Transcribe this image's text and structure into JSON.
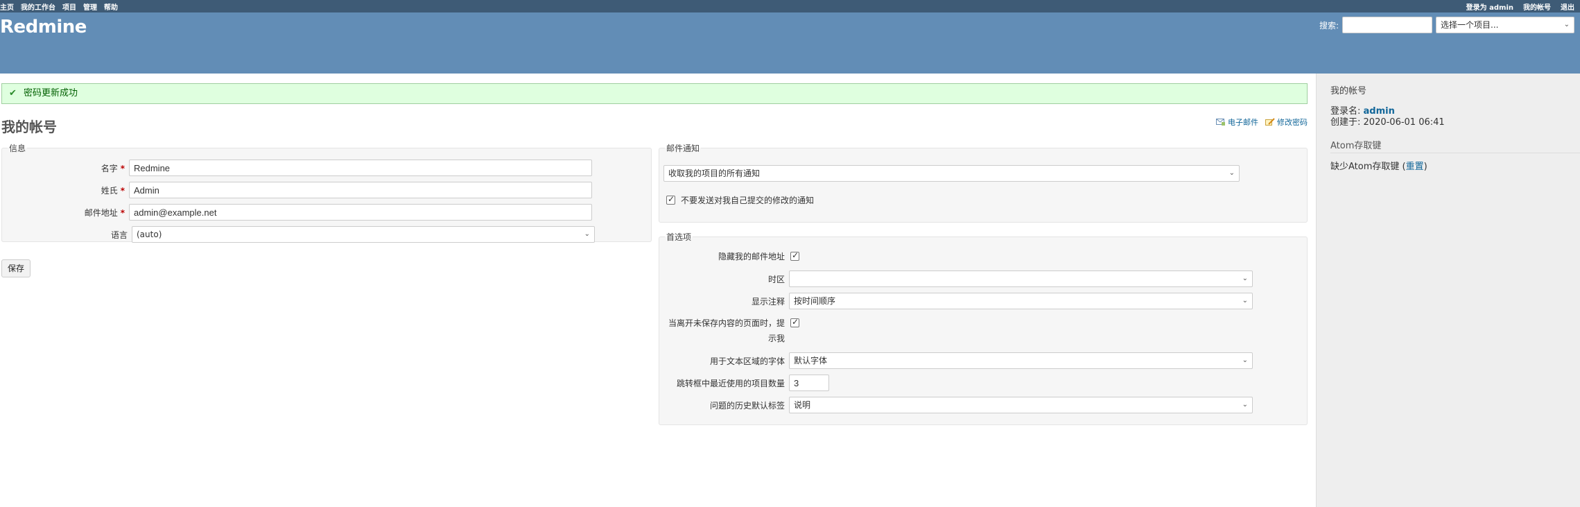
{
  "top_menu": {
    "left": [
      "主页",
      "我的工作台",
      "项目",
      "管理",
      "帮助"
    ],
    "logged_as_prefix": "登录为",
    "user": "admin",
    "my_account": "我的帐号",
    "logout": "退出"
  },
  "header": {
    "title": "Redmine",
    "search_label": "搜索:",
    "search_value": "",
    "project_jump": "选择一个项目..."
  },
  "flash": "密码更新成功",
  "page_title": "我的帐号",
  "contextual": {
    "email_link": "电子邮件",
    "password_link": "修改密码"
  },
  "info": {
    "legend": "信息",
    "fields": [
      {
        "label": "名字",
        "required": true,
        "value": "Redmine"
      },
      {
        "label": "姓氏",
        "required": true,
        "value": "Admin"
      },
      {
        "label": "邮件地址",
        "required": true,
        "value": "admin@example.net"
      }
    ],
    "language_label": "语言",
    "language_value": "(auto)"
  },
  "save_button": "保存",
  "mail": {
    "legend": "邮件通知",
    "select_value": "收取我的项目的所有通知",
    "no_self_notified_label": "不要发送对我自己提交的修改的通知",
    "no_self_notified_checked": true
  },
  "prefs": {
    "legend": "首选项",
    "hide_mail_label": "隐藏我的邮件地址",
    "hide_mail_checked": true,
    "timezone_label": "时区",
    "timezone_value": "",
    "comments_label": "显示注释",
    "comments_value": "按时间顺序",
    "warn_label_1": "当离开未保存内容的页面时，提",
    "warn_label_2": "示我",
    "warn_checked": true,
    "font_label": "用于文本区域的字体",
    "font_value": "默认字体",
    "recent_label": "跳转框中最近使用的项目数量",
    "recent_value": "3",
    "history_label": "问题的历史默认标签",
    "history_value": "说明"
  },
  "sidebar": {
    "title": "我的帐号",
    "login_label": "登录名:",
    "login_value": "admin",
    "created_label": "创建于:",
    "created_value": "2020-06-01 06:41",
    "atom_title": "Atom存取键",
    "atom_missing": "缺少Atom存取键",
    "reset_link": "重置"
  }
}
